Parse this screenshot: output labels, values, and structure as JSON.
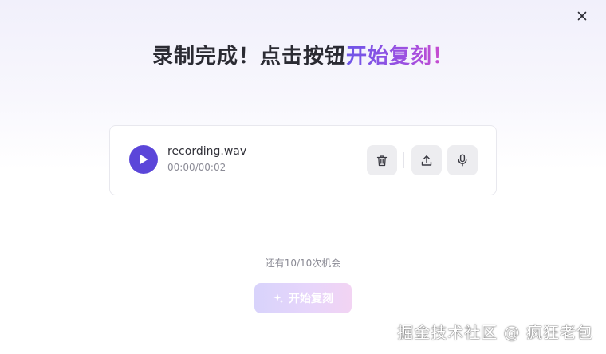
{
  "dialog": {
    "title_prefix": "录制完成！点击按钮",
    "title_accent": "开始复刻！"
  },
  "audio": {
    "file_name": "recording.wav",
    "time": "00:00/00:02"
  },
  "remaining_text": "还有10/10次机会",
  "start_button_label": "开始复刻",
  "watermark": "掘金技术社区 @ 疯狂老包",
  "icons": {
    "close": "close-icon",
    "play": "play-icon",
    "delete": "trash-icon",
    "upload": "upload-icon",
    "record": "microphone-icon",
    "sparkle": "sparkle-icon"
  },
  "colors": {
    "accent": "#5b46d9",
    "accent_gradient_start": "#6e56e8",
    "accent_gradient_end": "#d94bc8",
    "button_bg": "#ededf0"
  }
}
